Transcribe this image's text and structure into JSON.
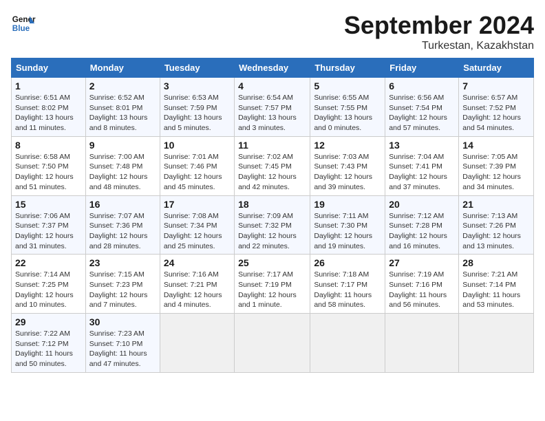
{
  "header": {
    "logo_line1": "General",
    "logo_line2": "Blue",
    "month": "September 2024",
    "location": "Turkestan, Kazakhstan"
  },
  "days_of_week": [
    "Sunday",
    "Monday",
    "Tuesday",
    "Wednesday",
    "Thursday",
    "Friday",
    "Saturday"
  ],
  "weeks": [
    [
      {
        "day": "1",
        "info": "Sunrise: 6:51 AM\nSunset: 8:02 PM\nDaylight: 13 hours and 11 minutes."
      },
      {
        "day": "2",
        "info": "Sunrise: 6:52 AM\nSunset: 8:01 PM\nDaylight: 13 hours and 8 minutes."
      },
      {
        "day": "3",
        "info": "Sunrise: 6:53 AM\nSunset: 7:59 PM\nDaylight: 13 hours and 5 minutes."
      },
      {
        "day": "4",
        "info": "Sunrise: 6:54 AM\nSunset: 7:57 PM\nDaylight: 13 hours and 3 minutes."
      },
      {
        "day": "5",
        "info": "Sunrise: 6:55 AM\nSunset: 7:55 PM\nDaylight: 13 hours and 0 minutes."
      },
      {
        "day": "6",
        "info": "Sunrise: 6:56 AM\nSunset: 7:54 PM\nDaylight: 12 hours and 57 minutes."
      },
      {
        "day": "7",
        "info": "Sunrise: 6:57 AM\nSunset: 7:52 PM\nDaylight: 12 hours and 54 minutes."
      }
    ],
    [
      {
        "day": "8",
        "info": "Sunrise: 6:58 AM\nSunset: 7:50 PM\nDaylight: 12 hours and 51 minutes."
      },
      {
        "day": "9",
        "info": "Sunrise: 7:00 AM\nSunset: 7:48 PM\nDaylight: 12 hours and 48 minutes."
      },
      {
        "day": "10",
        "info": "Sunrise: 7:01 AM\nSunset: 7:46 PM\nDaylight: 12 hours and 45 minutes."
      },
      {
        "day": "11",
        "info": "Sunrise: 7:02 AM\nSunset: 7:45 PM\nDaylight: 12 hours and 42 minutes."
      },
      {
        "day": "12",
        "info": "Sunrise: 7:03 AM\nSunset: 7:43 PM\nDaylight: 12 hours and 39 minutes."
      },
      {
        "day": "13",
        "info": "Sunrise: 7:04 AM\nSunset: 7:41 PM\nDaylight: 12 hours and 37 minutes."
      },
      {
        "day": "14",
        "info": "Sunrise: 7:05 AM\nSunset: 7:39 PM\nDaylight: 12 hours and 34 minutes."
      }
    ],
    [
      {
        "day": "15",
        "info": "Sunrise: 7:06 AM\nSunset: 7:37 PM\nDaylight: 12 hours and 31 minutes."
      },
      {
        "day": "16",
        "info": "Sunrise: 7:07 AM\nSunset: 7:36 PM\nDaylight: 12 hours and 28 minutes."
      },
      {
        "day": "17",
        "info": "Sunrise: 7:08 AM\nSunset: 7:34 PM\nDaylight: 12 hours and 25 minutes."
      },
      {
        "day": "18",
        "info": "Sunrise: 7:09 AM\nSunset: 7:32 PM\nDaylight: 12 hours and 22 minutes."
      },
      {
        "day": "19",
        "info": "Sunrise: 7:11 AM\nSunset: 7:30 PM\nDaylight: 12 hours and 19 minutes."
      },
      {
        "day": "20",
        "info": "Sunrise: 7:12 AM\nSunset: 7:28 PM\nDaylight: 12 hours and 16 minutes."
      },
      {
        "day": "21",
        "info": "Sunrise: 7:13 AM\nSunset: 7:26 PM\nDaylight: 12 hours and 13 minutes."
      }
    ],
    [
      {
        "day": "22",
        "info": "Sunrise: 7:14 AM\nSunset: 7:25 PM\nDaylight: 12 hours and 10 minutes."
      },
      {
        "day": "23",
        "info": "Sunrise: 7:15 AM\nSunset: 7:23 PM\nDaylight: 12 hours and 7 minutes."
      },
      {
        "day": "24",
        "info": "Sunrise: 7:16 AM\nSunset: 7:21 PM\nDaylight: 12 hours and 4 minutes."
      },
      {
        "day": "25",
        "info": "Sunrise: 7:17 AM\nSunset: 7:19 PM\nDaylight: 12 hours and 1 minute."
      },
      {
        "day": "26",
        "info": "Sunrise: 7:18 AM\nSunset: 7:17 PM\nDaylight: 11 hours and 58 minutes."
      },
      {
        "day": "27",
        "info": "Sunrise: 7:19 AM\nSunset: 7:16 PM\nDaylight: 11 hours and 56 minutes."
      },
      {
        "day": "28",
        "info": "Sunrise: 7:21 AM\nSunset: 7:14 PM\nDaylight: 11 hours and 53 minutes."
      }
    ],
    [
      {
        "day": "29",
        "info": "Sunrise: 7:22 AM\nSunset: 7:12 PM\nDaylight: 11 hours and 50 minutes."
      },
      {
        "day": "30",
        "info": "Sunrise: 7:23 AM\nSunset: 7:10 PM\nDaylight: 11 hours and 47 minutes."
      },
      {
        "day": "",
        "info": ""
      },
      {
        "day": "",
        "info": ""
      },
      {
        "day": "",
        "info": ""
      },
      {
        "day": "",
        "info": ""
      },
      {
        "day": "",
        "info": ""
      }
    ]
  ]
}
